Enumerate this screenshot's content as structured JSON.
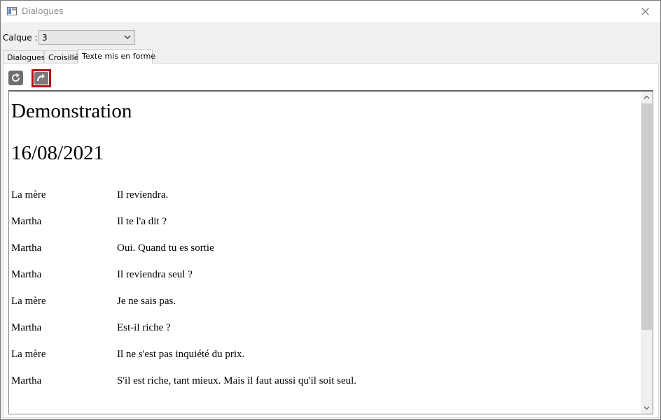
{
  "window": {
    "title": "Dialogues"
  },
  "layer": {
    "label": "Calque :",
    "selected": "3"
  },
  "tabs": [
    {
      "label": "Dialogues"
    },
    {
      "label": "Croisillé"
    },
    {
      "label": "Texte mis en forme"
    }
  ],
  "document": {
    "title": "Demonstration",
    "date": "16/08/2021",
    "lines": [
      {
        "speaker": "La mère",
        "text": "Il reviendra."
      },
      {
        "speaker": "Martha",
        "text": "Il te l'a dit ?"
      },
      {
        "speaker": "Martha",
        "text": "Oui. Quand tu es sortie"
      },
      {
        "speaker": "Martha",
        "text": "Il reviendra seul ?"
      },
      {
        "speaker": "La mère",
        "text": "Je ne sais pas."
      },
      {
        "speaker": "Martha",
        "text": "Est-il riche ?"
      },
      {
        "speaker": "La mère",
        "text": "Il ne s'est pas inquiété du prix."
      },
      {
        "speaker": "Martha",
        "text": "S'il est riche, tant mieux. Mais il faut aussi qu'il soit seul."
      }
    ]
  },
  "icons": {
    "app": "window-icon",
    "close": "close-icon",
    "dropdown": "chevron-down-icon",
    "refresh": "refresh-icon",
    "export": "export-arrow-icon"
  },
  "colors": {
    "highlight_border": "#b8111b",
    "scroll_thumb": "#cdcdcd"
  }
}
